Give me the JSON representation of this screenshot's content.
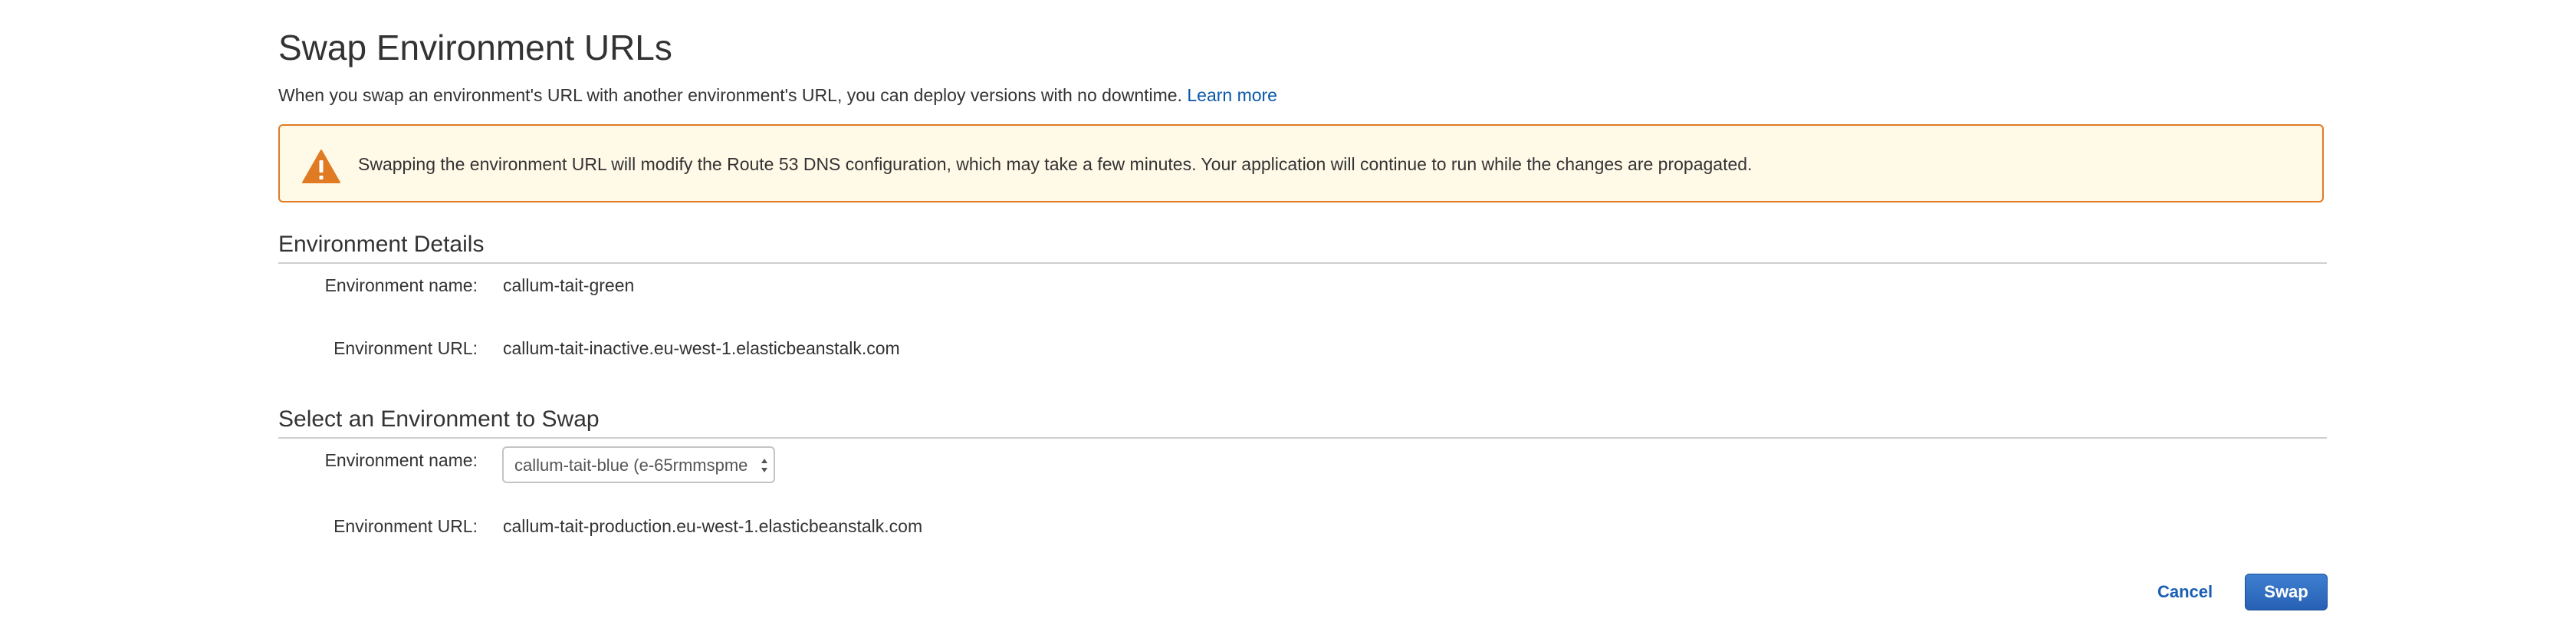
{
  "page": {
    "title": "Swap Environment URLs",
    "intro_text": "When you swap an environment's URL with another environment's URL, you can deploy versions with no downtime.",
    "learn_more_label": "Learn more"
  },
  "alert": {
    "icon": "warning-icon",
    "text": "Swapping the environment URL will modify the Route 53 DNS configuration, which may take a few minutes. Your application will continue to run while the changes are propagated.",
    "border_color": "#e07b24",
    "background_color": "#fff9e8"
  },
  "environment_details": {
    "heading": "Environment Details",
    "name_label": "Environment name:",
    "name_value": "callum-tait-green",
    "url_label": "Environment URL:",
    "url_value": "callum-tait-inactive.eu-west-1.elasticbeanstalk.com"
  },
  "swap_target": {
    "heading": "Select an Environment to Swap",
    "name_label": "Environment name:",
    "selected_option": "callum-tait-blue (e-65rmmspme",
    "url_label": "Environment URL:",
    "url_value": "callum-tait-production.eu-west-1.elasticbeanstalk.com"
  },
  "actions": {
    "cancel_label": "Cancel",
    "swap_label": "Swap",
    "primary_color": "#2760b4",
    "link_color": "#1a5fb4"
  }
}
